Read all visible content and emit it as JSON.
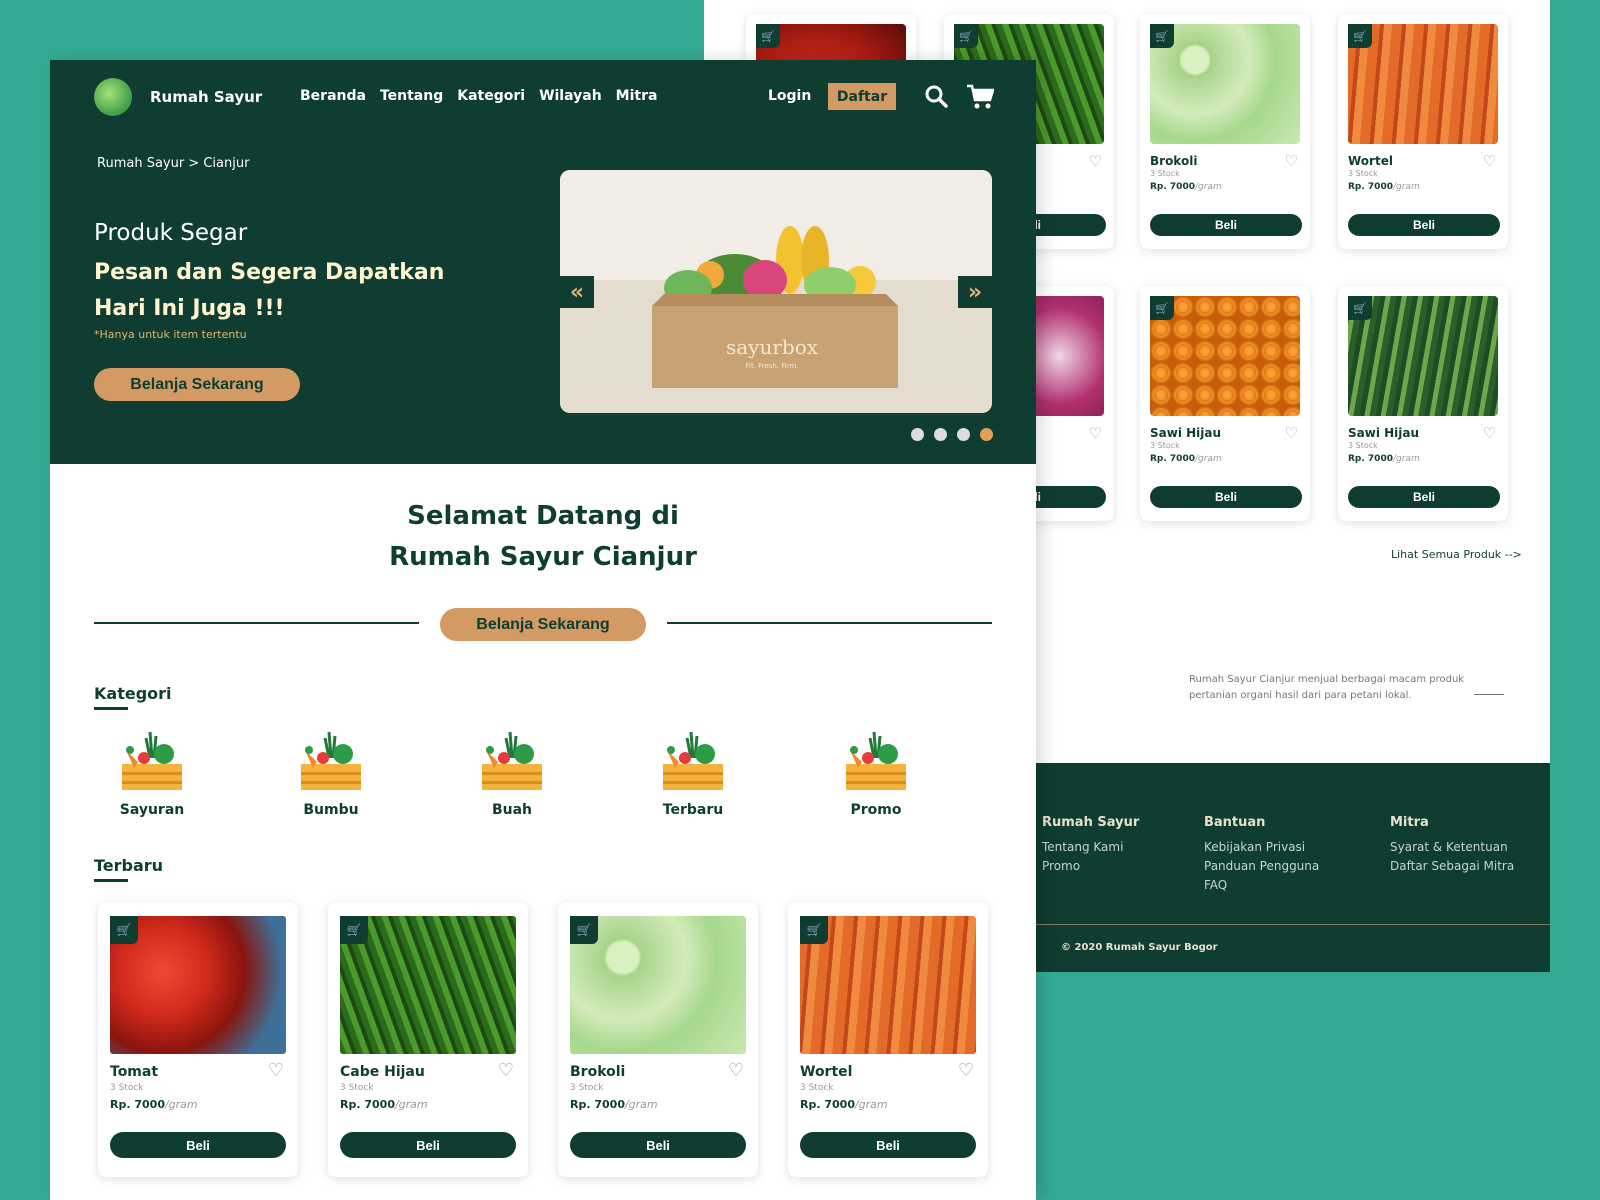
{
  "header": {
    "brand": "Rumah Sayur",
    "nav": [
      "Beranda",
      "Tentang",
      "Kategori",
      "Wilayah",
      "Mitra"
    ],
    "login": "Login",
    "register": "Daftar"
  },
  "hero": {
    "breadcrumb": "Rumah Sayur > Cianjur",
    "title": "Produk Segar",
    "headline": "Pesan dan Segera Dapatkan Hari Ini Juga !!!",
    "note": "*Hanya untuk item tertentu",
    "cta": "Belanja Sekarang",
    "box_label": "sayurbox",
    "box_sub": "Fit. Fresh. Firm.",
    "slide_count": 4,
    "active_slide": 4
  },
  "welcome": {
    "line1": "Selamat Datang di",
    "line2": "Rumah Sayur Cianjur",
    "cta": "Belanja Sekarang"
  },
  "categories": {
    "title": "Kategori",
    "items": [
      "Sayuran",
      "Bumbu",
      "Buah",
      "Terbaru",
      "Promo"
    ]
  },
  "latest": {
    "title": "Terbaru",
    "products": [
      {
        "name": "Tomat",
        "stock": "3 Stock",
        "price": "Rp. 7000",
        "unit": "/gram",
        "buy": "Beli"
      },
      {
        "name": "Cabe Hijau",
        "stock": "3 Stock",
        "price": "Rp. 7000",
        "unit": "/gram",
        "buy": "Beli"
      },
      {
        "name": "Brokoli",
        "stock": "3 Stock",
        "price": "Rp. 7000",
        "unit": "/gram",
        "buy": "Beli"
      },
      {
        "name": "Wortel",
        "stock": "3 Stock",
        "price": "Rp. 7000",
        "unit": "/gram",
        "buy": "Beli"
      }
    ]
  },
  "back_page": {
    "products": [
      {
        "name": "Brokoli",
        "stock": "3 Stock",
        "price": "Rp. 7000",
        "unit": "/gram",
        "buy": "Beli"
      },
      {
        "name": "Wortel",
        "stock": "3 Stock",
        "price": "Rp. 7000",
        "unit": "/gram",
        "buy": "Beli"
      },
      {
        "name": "Sawi Hijau",
        "stock": "3 Stock",
        "price": "Rp. 7000",
        "unit": "/gram",
        "buy": "Beli"
      },
      {
        "name": "Sawi Hijau",
        "stock": "3 Stock",
        "price": "Rp. 7000",
        "unit": "/gram",
        "buy": "Beli"
      }
    ],
    "partial_buy": "Beli",
    "see_all": "Lihat Semua Produk -->",
    "description": "Rumah Sayur Cianjur menjual berbagai macam produk pertanian organi hasil dari para petani lokal.",
    "footer": {
      "col1_title": "Rumah Sayur",
      "col1_links": [
        "Tentang Kami",
        "Promo"
      ],
      "col2_title": "Bantuan",
      "col2_links": [
        "Kebijakan Privasi",
        "Panduan Pengguna",
        "FAQ"
      ],
      "col3_title": "Mitra",
      "col3_links": [
        "Syarat & Ketentuan",
        "Daftar Sebagai Mitra"
      ],
      "copyright": "© 2020 Rumah Sayur Bogor"
    }
  },
  "colors": {
    "background": "#35aa93",
    "primary": "#0f3d32",
    "accent": "#d39a63"
  }
}
